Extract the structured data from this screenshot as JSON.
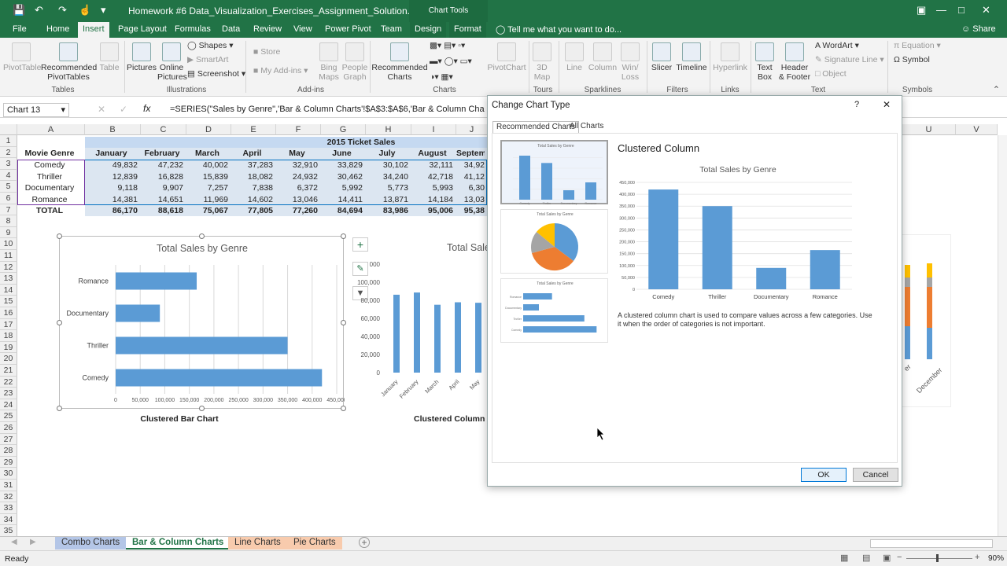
{
  "window": {
    "title": "Homework #6 Data_Visualization_Exercises_Assignment_Solution.xlsx - Excel",
    "context_tools": "Chart Tools",
    "share": "Share",
    "tell_me": "Tell me what you want to do..."
  },
  "tabs": [
    "File",
    "Home",
    "Insert",
    "Page Layout",
    "Formulas",
    "Data",
    "Review",
    "View",
    "Power Pivot",
    "Team",
    "Design",
    "Format"
  ],
  "ribbon": {
    "tables": {
      "label": "Tables",
      "pivottable": "PivotTable",
      "recommended_pivottables": "Recommended PivotTables",
      "table": "Table"
    },
    "illustrations": {
      "label": "Illustrations",
      "pictures": "Pictures",
      "online_pictures": "Online Pictures",
      "shapes": "Shapes",
      "smartart": "SmartArt",
      "screenshot": "Screenshot"
    },
    "addins": {
      "label": "Add-ins",
      "store": "Store",
      "my_addins": "My Add-ins",
      "bing_maps": "Bing Maps",
      "people_graph": "People Graph"
    },
    "charts": {
      "label": "Charts",
      "recommended_charts": "Recommended Charts",
      "pivotchart": "PivotChart"
    },
    "tours": {
      "label": "Tours",
      "map3d": "3D Map"
    },
    "sparklines": {
      "label": "Sparklines",
      "line": "Line",
      "column": "Column",
      "winloss": "Win/ Loss"
    },
    "filters": {
      "label": "Filters",
      "slicer": "Slicer",
      "timeline": "Timeline"
    },
    "links": {
      "label": "Links",
      "hyperlink": "Hyperlink"
    },
    "text": {
      "label": "Text",
      "text_box": "Text Box",
      "header_footer": "Header & Footer",
      "wordart": "WordArt",
      "signature_line": "Signature Line",
      "object": "Object"
    },
    "symbols": {
      "label": "Symbols",
      "equation": "Equation",
      "symbol": "Symbol"
    }
  },
  "formula_bar": {
    "name_box": "Chart 13",
    "formula": "=SERIES(\"Sales by Genre\",'Bar & Column Charts'!$A$3:$A$6,'Bar & Column Charts'!"
  },
  "columns": [
    "A",
    "B",
    "C",
    "D",
    "E",
    "F",
    "G",
    "H",
    "I",
    "J",
    "U",
    "V"
  ],
  "rows": [
    "1",
    "2",
    "3",
    "4",
    "5",
    "6",
    "7",
    "8",
    "9",
    "10",
    "11",
    "12",
    "13",
    "14",
    "15",
    "16",
    "17",
    "18",
    "19",
    "20",
    "21",
    "22",
    "23",
    "24",
    "25",
    "26",
    "27",
    "28",
    "29",
    "30",
    "31",
    "32",
    "33",
    "34",
    "35"
  ],
  "table": {
    "banner": "2015 Ticket Sales",
    "header": [
      "Movie Genre",
      "January",
      "February",
      "March",
      "April",
      "May",
      "June",
      "July",
      "August",
      "Septem"
    ],
    "rows": [
      [
        "Comedy",
        "49,832",
        "47,232",
        "40,002",
        "37,283",
        "32,910",
        "33,829",
        "30,102",
        "32,111",
        "34,92"
      ],
      [
        "Thriller",
        "12,839",
        "16,828",
        "15,839",
        "18,082",
        "24,932",
        "30,462",
        "34,240",
        "42,718",
        "41,12"
      ],
      [
        "Documentary",
        "9,118",
        "9,907",
        "7,257",
        "7,838",
        "6,372",
        "5,992",
        "5,773",
        "5,993",
        "6,30"
      ],
      [
        "Romance",
        "14,381",
        "14,651",
        "11,969",
        "14,602",
        "13,046",
        "14,411",
        "13,871",
        "14,184",
        "13,03"
      ],
      [
        "TOTAL",
        "86,170",
        "88,618",
        "75,067",
        "77,805",
        "77,260",
        "84,694",
        "83,986",
        "95,006",
        "95,38"
      ]
    ]
  },
  "bar_chart": {
    "title": "Total Sales by Genre",
    "caption": "Clustered Bar Chart",
    "categories": [
      "Comedy",
      "Thriller",
      "Documentary",
      "Romance"
    ],
    "values": [
      420000,
      350000,
      90000,
      165000
    ],
    "ticks": [
      "0",
      "50,000",
      "100,000",
      "150,000",
      "200,000",
      "250,000",
      "300,000",
      "350,000",
      "400,000",
      "450,000"
    ]
  },
  "column_chart": {
    "title": "Total Sale",
    "caption": "Clustered Column C",
    "ticks": [
      "0",
      "20,000",
      "40,000",
      "60,000",
      "80,000",
      "100,000",
      "000"
    ],
    "months": [
      "January",
      "February",
      "March",
      "April",
      "May"
    ],
    "values": [
      86170,
      88618,
      75067,
      77805,
      77260
    ]
  },
  "right_chart": {
    "label": "December",
    "label2": "er"
  },
  "dialog": {
    "title": "Change Chart Type",
    "help": "?",
    "close": "✕",
    "tabs": [
      "Recommended Charts",
      "All Charts"
    ],
    "chart_name": "Clustered Column",
    "preview_title": "Total Sales by Genre",
    "description": "A clustered column chart is used to compare values across a few categories. Use it when the order of categories is not important.",
    "ok": "OK",
    "cancel": "Cancel",
    "thumb_title": "Total Sales by Genre",
    "thumb_categories": [
      "Comedy",
      "Thriller",
      "Documentary",
      "Romance"
    ]
  },
  "chart_data": {
    "type": "bar",
    "title": "Total Sales by Genre",
    "categories": [
      "Comedy",
      "Thriller",
      "Documentary",
      "Romance"
    ],
    "values": [
      420000,
      350000,
      90000,
      165000
    ],
    "ylim": [
      0,
      450000
    ],
    "ticks": [
      "0",
      "50,000",
      "100,000",
      "150,000",
      "200,000",
      "250,000",
      "300,000",
      "350,000",
      "400,000",
      "450,000"
    ]
  },
  "sheets": [
    "Combo Charts",
    "Bar & Column Charts",
    "Line Charts",
    "Pie Charts"
  ],
  "status": {
    "ready": "Ready",
    "zoom": "90%"
  },
  "colors": {
    "excel_green": "#217346",
    "bar_blue": "#5b9bd5",
    "orange": "#ed7d31",
    "gray": "#a5a5a5",
    "gold": "#ffc000"
  }
}
